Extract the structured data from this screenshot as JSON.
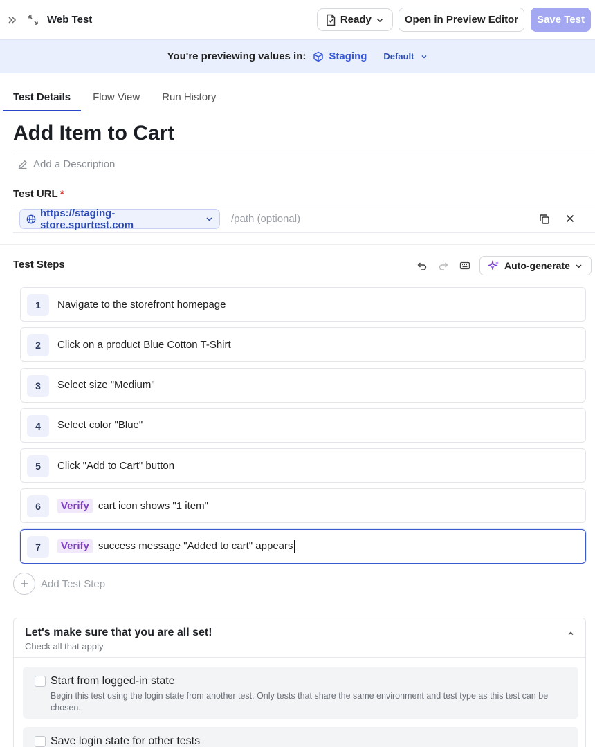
{
  "topbar": {
    "title": "Web Test",
    "status": "Ready",
    "preview_button": "Open in Preview Editor",
    "save_button": "Save Test"
  },
  "env_banner": {
    "lead": "You're previewing values in:",
    "environment": "Staging",
    "variant": "Default"
  },
  "tabs": [
    {
      "label": "Test Details",
      "active": true
    },
    {
      "label": "Flow View",
      "active": false
    },
    {
      "label": "Run History",
      "active": false
    }
  ],
  "test": {
    "title": "Add Item to Cart",
    "add_description": "Add a Description",
    "url_label": "Test URL",
    "url_required_mark": "*",
    "base_url": "https://staging-store.spurtest.com",
    "path_placeholder": "/path (optional)"
  },
  "steps_section": {
    "label": "Test Steps",
    "autogen_label": "Auto-generate",
    "add_step": "Add Test Step",
    "steps": [
      {
        "num": "1",
        "tag": "",
        "text": "Navigate to the storefront homepage"
      },
      {
        "num": "2",
        "tag": "",
        "text": "Click on a product Blue Cotton T-Shirt"
      },
      {
        "num": "3",
        "tag": "",
        "text": "Select size \"Medium\""
      },
      {
        "num": "4",
        "tag": "",
        "text": "Select color \"Blue\""
      },
      {
        "num": "5",
        "tag": "",
        "text": "Click \"Add to Cart\" button"
      },
      {
        "num": "6",
        "tag": "Verify",
        "text": "cart icon shows \"1 item\""
      },
      {
        "num": "7",
        "tag": "Verify",
        "text": "success message \"Added to cart\" appears"
      }
    ]
  },
  "checklist": {
    "title": "Let's make sure that you are all set!",
    "subtitle": "Check all that apply",
    "options": [
      {
        "title": "Start from logged-in state",
        "desc": "Begin this test using the login state from another test. Only tests that share the same environment and test type as this test can be chosen."
      },
      {
        "title": "Save login state for other tests",
        "desc": ""
      }
    ]
  },
  "colors": {
    "accent": "#2a47c9",
    "save_button_bg": "#a4a8f3",
    "banner_bg": "#e9effc",
    "verify_tag_bg": "#f2e8fb",
    "verify_tag_text": "#7e3fc2"
  }
}
